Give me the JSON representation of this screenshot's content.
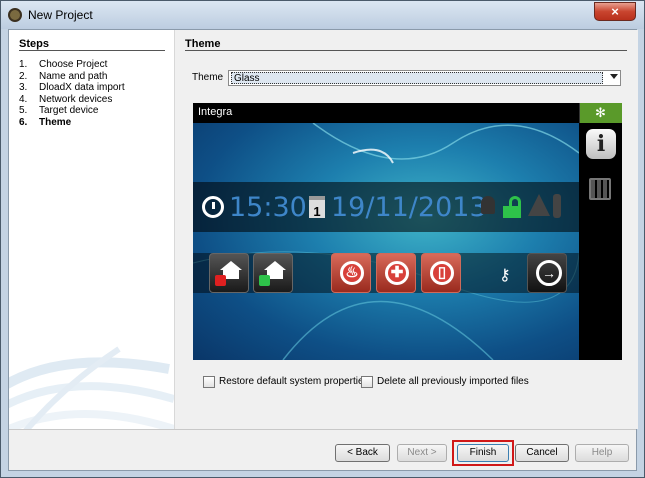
{
  "window": {
    "title": "New Project",
    "close_glyph": "×"
  },
  "steps": {
    "header": "Steps",
    "items": [
      {
        "num": "1.",
        "label": "Choose Project",
        "active": false
      },
      {
        "num": "2.",
        "label": "Name and path",
        "active": false
      },
      {
        "num": "3.",
        "label": "DloadX data import",
        "active": false
      },
      {
        "num": "4.",
        "label": "Network devices",
        "active": false
      },
      {
        "num": "5.",
        "label": "Target device",
        "active": false
      },
      {
        "num": "6.",
        "label": "Theme",
        "active": true
      }
    ]
  },
  "main": {
    "header": "Theme",
    "theme_label": "Theme",
    "theme_value": "Glass"
  },
  "preview": {
    "title": "Integra",
    "time": "15:30",
    "date": "19/11/2013",
    "info_glyph": "i",
    "snowflake_glyph": "✻",
    "calendar_day": "1",
    "key_glyph": "⚷",
    "exit_glyph": "→",
    "fire_glyph": "♨",
    "medical_glyph": "✚",
    "door_glyph": "▯",
    "accent_color": "#3e86c9",
    "unlocked_color": "#2ec24a"
  },
  "options": {
    "restore_label": "Restore default system properties",
    "delete_label": "Delete all previously imported files",
    "restore_checked": false,
    "delete_checked": false
  },
  "buttons": {
    "back": "< Back",
    "next": "Next >",
    "finish": "Finish",
    "cancel": "Cancel",
    "help": "Help"
  }
}
